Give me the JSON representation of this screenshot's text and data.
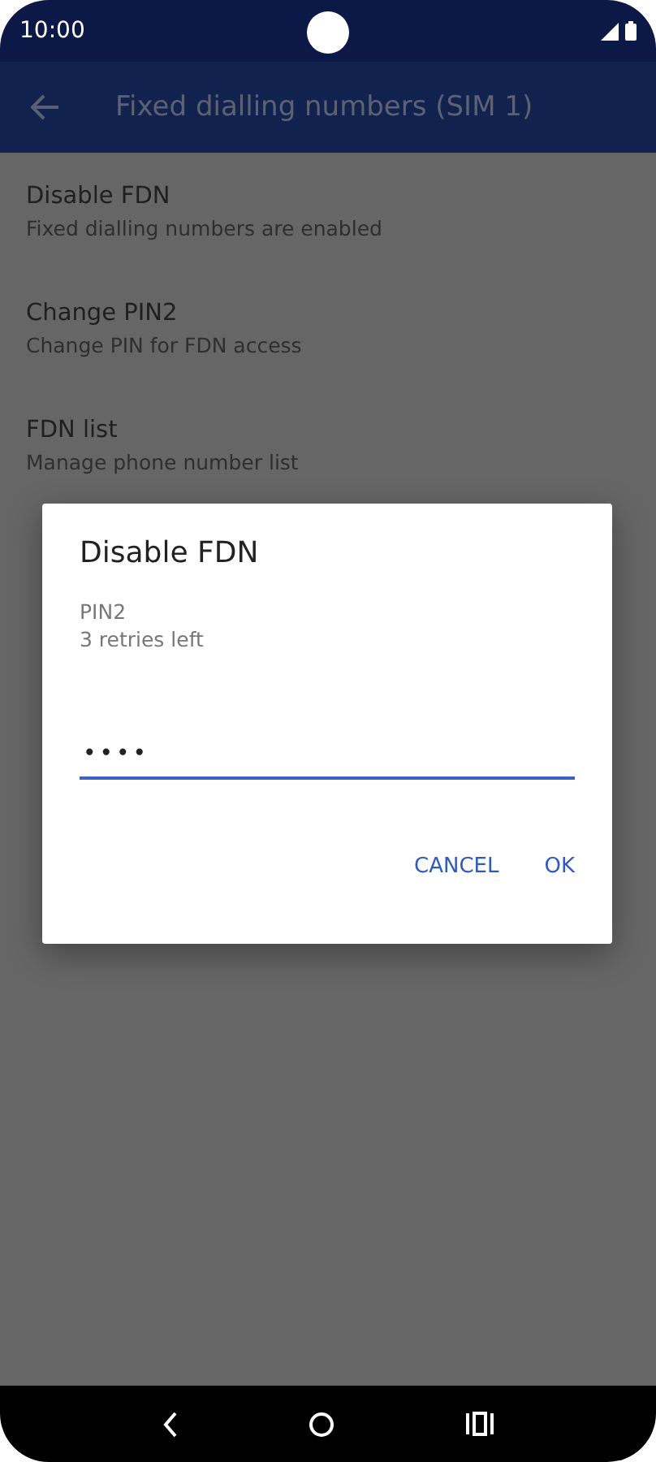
{
  "status_bar": {
    "time": "10:00"
  },
  "app_bar": {
    "title": "Fixed dialling numbers (SIM 1)"
  },
  "settings": [
    {
      "title": "Disable FDN",
      "subtitle": "Fixed dialling numbers are enabled"
    },
    {
      "title": "Change PIN2",
      "subtitle": "Change PIN for FDN access"
    },
    {
      "title": "FDN list",
      "subtitle": "Manage phone number list"
    }
  ],
  "dialog": {
    "title": "Disable FDN",
    "label": "PIN2",
    "hint": "3 retries left",
    "value": "••••",
    "buttons": [
      "CANCEL",
      "OK"
    ]
  }
}
